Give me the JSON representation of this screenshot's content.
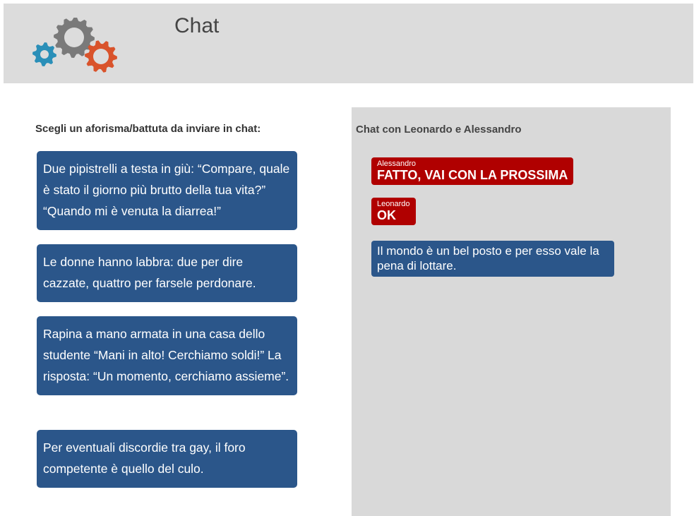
{
  "header": {
    "title": "Chat",
    "logo_icon": "gears-logo-icon",
    "colors": {
      "background": "#dcdcdc",
      "gear_gray": "#7a7a7a",
      "gear_blue": "#2a8fb8",
      "gear_orange": "#d9532b"
    }
  },
  "left": {
    "heading": "Scegli un aforisma/battuta da inviare in chat:",
    "quotes": [
      "Due pipistrelli a testa in giù: “Compare, quale è stato il giorno più brutto della tua vita?” “Quando mi è venuta la diarrea!”",
      "Le donne hanno labbra: due per dire cazzate, quattro per farsele perdonare.",
      "Rapina a mano armata in una casa dello studente “Mani in alto! Cerchiamo soldi!” La risposta: “Un momento, cerchiamo assieme”.",
      "Per eventuali discordie tra gay, il foro competente è quello del culo."
    ],
    "quote_color": "#2b568a"
  },
  "chat": {
    "heading": "Chat con Leonardo e Alessandro",
    "messages": [
      {
        "sender": "Alessandro",
        "text": "FATTO, VAI CON LA PROSSIMA"
      },
      {
        "sender": "Leonardo",
        "text": "OK"
      },
      {
        "sender": "",
        "text": "Il mondo è un bel posto e per esso vale la pena di lottare."
      }
    ],
    "colors": {
      "panel": "#d9d9d9",
      "other_message": "#b00000",
      "own_message": "#2b568a"
    }
  }
}
